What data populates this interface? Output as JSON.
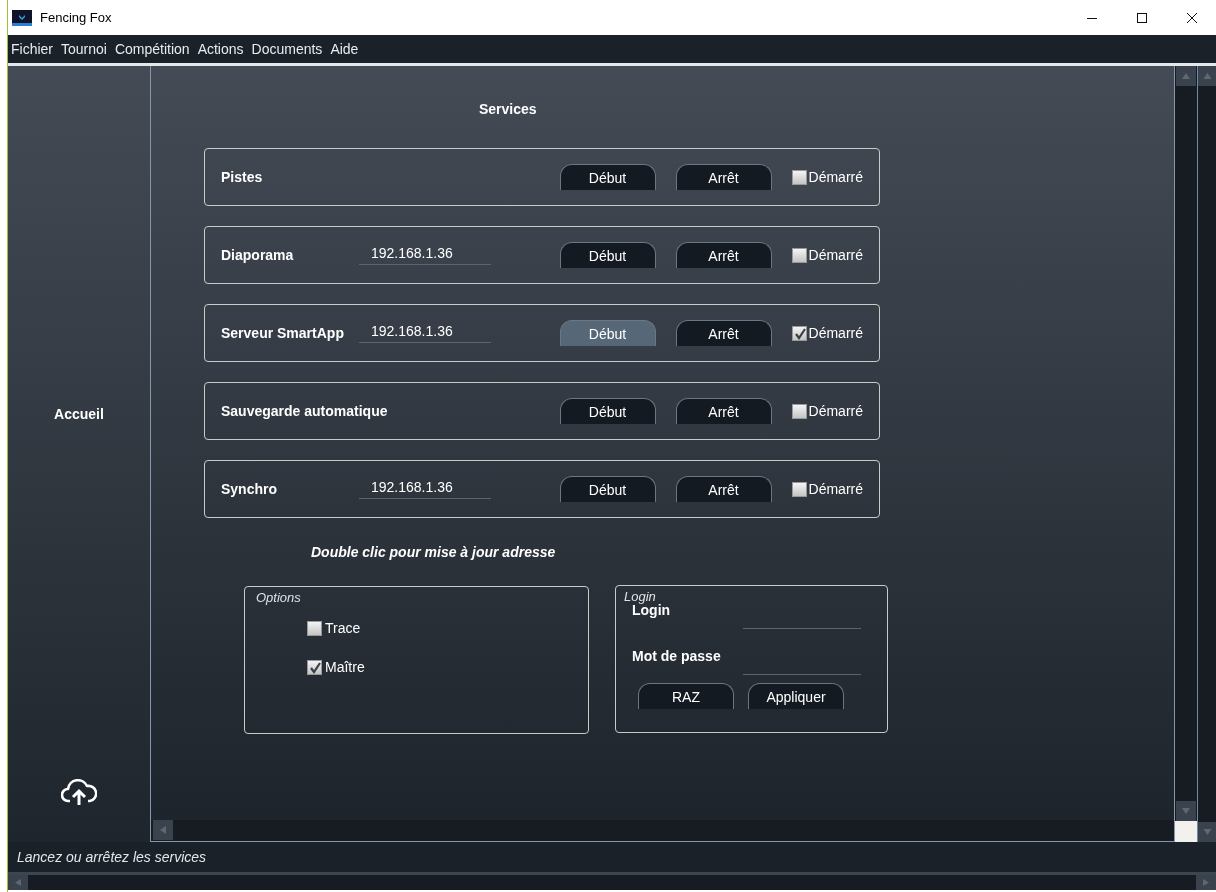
{
  "window": {
    "title": "Fencing Fox"
  },
  "menu": [
    "Fichier",
    "Tournoi",
    "Compétition",
    "Actions",
    "Documents",
    "Aide"
  ],
  "sidebar": {
    "items": [
      {
        "label": "Accueil"
      }
    ]
  },
  "services": {
    "title": "Services",
    "rows": [
      {
        "name": "Pistes",
        "buttons": [
          {
            "label": "Début",
            "highlighted": false
          },
          {
            "label": "Arrêt",
            "highlighted": false
          }
        ],
        "status": {
          "label": "Démarré",
          "checked": false
        }
      },
      {
        "name": "Diaporama",
        "address": "192.168.1.36",
        "buttons": [
          {
            "label": "Début",
            "highlighted": false
          },
          {
            "label": "Arrêt",
            "highlighted": false
          }
        ],
        "status": {
          "label": "Démarré",
          "checked": false
        }
      },
      {
        "name": "Serveur SmartApp",
        "address": "192.168.1.36",
        "buttons": [
          {
            "label": "Début",
            "highlighted": true
          },
          {
            "label": "Arrêt",
            "highlighted": false
          }
        ],
        "status": {
          "label": "Démarré",
          "checked": true
        }
      },
      {
        "name": "Sauvegarde automatique",
        "buttons": [
          {
            "label": "Début",
            "highlighted": false
          },
          {
            "label": "Arrêt",
            "highlighted": false
          }
        ],
        "status": {
          "label": "Démarré",
          "checked": false
        }
      },
      {
        "name": "Synchro",
        "address": "192.168.1.36",
        "buttons": [
          {
            "label": "Début",
            "highlighted": false
          },
          {
            "label": "Arrêt",
            "highlighted": false
          }
        ],
        "status": {
          "label": "Démarré",
          "checked": false
        }
      }
    ],
    "hint": "Double clic pour mise à jour adresse"
  },
  "options": {
    "title": "Options",
    "checkboxes": [
      {
        "label": "Trace",
        "checked": false
      },
      {
        "label": "Maître",
        "checked": true
      }
    ]
  },
  "login": {
    "title": "Login",
    "fields": [
      {
        "label": "Login"
      },
      {
        "label": "Mot de passe"
      }
    ],
    "buttons": [
      "RAZ",
      "Appliquer"
    ]
  },
  "status_bar": "Lancez ou arrêtez les services"
}
